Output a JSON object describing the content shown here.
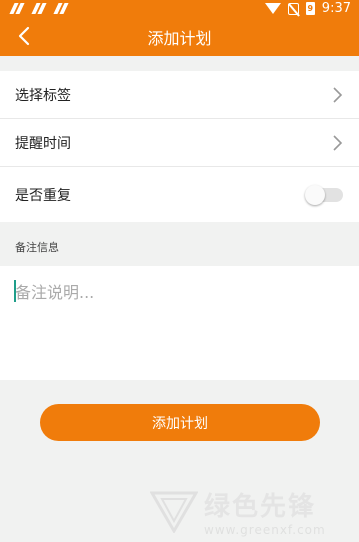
{
  "status_bar": {
    "time": "9:37",
    "battery_level": "9"
  },
  "header": {
    "title": "添加计划"
  },
  "settings": {
    "select_tag_label": "选择标签",
    "reminder_time_label": "提醒时间",
    "repeat_label": "是否重复",
    "repeat_enabled": false
  },
  "notes": {
    "section_label": "备注信息",
    "placeholder": "备注说明..."
  },
  "actions": {
    "submit_label": "添加计划"
  },
  "watermark": {
    "title": "绿色先锋",
    "url": "www.greenxf.com"
  },
  "colors": {
    "accent": "#f07c0b",
    "background": "#f1f2f1"
  }
}
